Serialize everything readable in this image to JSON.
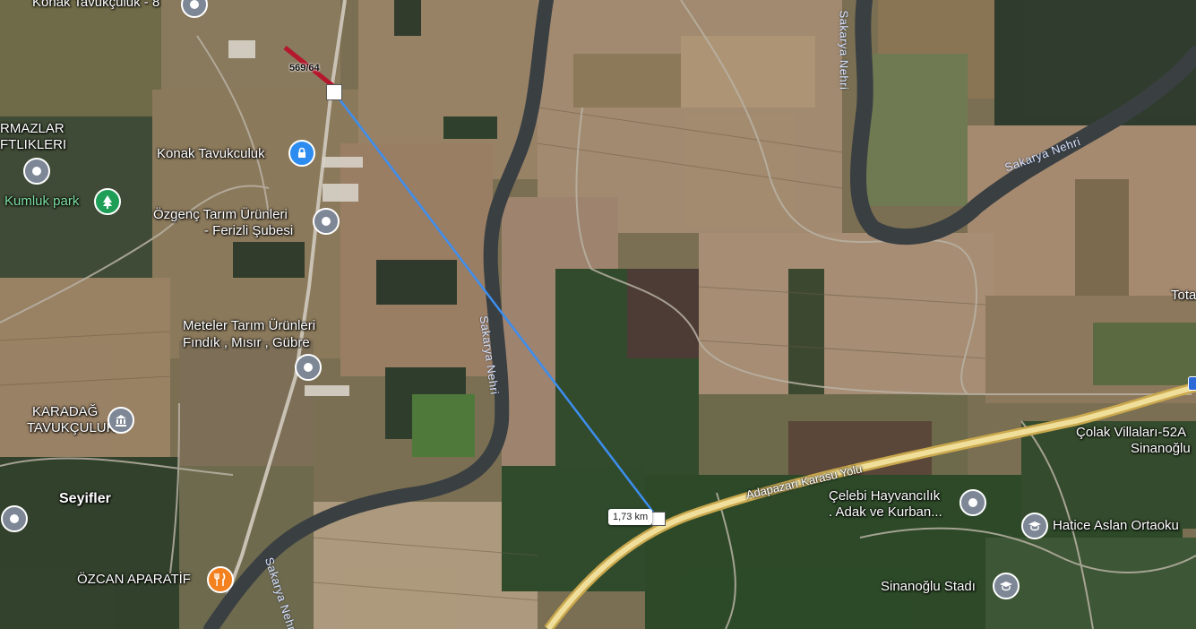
{
  "colors": {
    "river": "#3a3f42",
    "measure_line": "#3d8ef0",
    "highway": "#e8d48a",
    "parcel": "#b5172c",
    "pin_grey": "#7d8796",
    "pin_blue": "#2d8cf0",
    "pin_green": "#1f9e57",
    "pin_orange": "#f4811f"
  },
  "labels": {
    "konak_8": "Konak Tavukçuluk - 8",
    "kirmazlar_1": "RMAZLAR",
    "kirmazlar_2": "FTLIKLERI",
    "konak_tavukculuk": "Konak Tavukculuk",
    "kumluk_park": "Kumluk park",
    "ozgenc_1": "Özgenç Tarım Ürünleri",
    "ozgenc_2": "- Ferizli Şubesi",
    "meteler_1": "Meteler Tarım Ürünleri",
    "meteler_2": "Fındık , Mısır , Gübre",
    "karadag_1": "KARADAĞ",
    "karadag_2": "TAVUKÇULUK",
    "seyifler": "Seyifler",
    "ozcan": "ÖZCAN APARATİF",
    "celebi_1": "Çelebi Hayvancılık",
    "celebi_2": ". Adak ve Kurban...",
    "colak_1": "Çolak Villaları-52A",
    "colak_2": "Sinanoğlu",
    "hatice": "Hatice Aslan Ortaoku",
    "sinanoglu_stadi": "Sinanoğlu Stadı",
    "tota": "Tota",
    "road_adapazari": "Adapazarı Karasu Yolu",
    "river_1": "Sakarya Nehri",
    "river_2": "Sakarya Nehri",
    "river_3": "Sakarya Nehri",
    "river_4": "Sakarya Nehri"
  },
  "measurement": {
    "parcel_label": "569/64",
    "distance": "1,73 km"
  },
  "icons": {
    "pin_konak_8": "map-pin-icon",
    "pin_kirmazlar": "map-pin-icon",
    "pin_konak": "lock-icon",
    "pin_park": "tree-icon",
    "pin_ozgenc": "map-pin-icon",
    "pin_meteler": "map-pin-icon",
    "pin_karadag": "building-icon",
    "pin_seyifler": "map-pin-icon",
    "pin_ozcan": "restaurant-icon",
    "pin_celebi": "map-pin-icon",
    "pin_hatice": "school-icon",
    "pin_stadi": "stadium-icon"
  }
}
